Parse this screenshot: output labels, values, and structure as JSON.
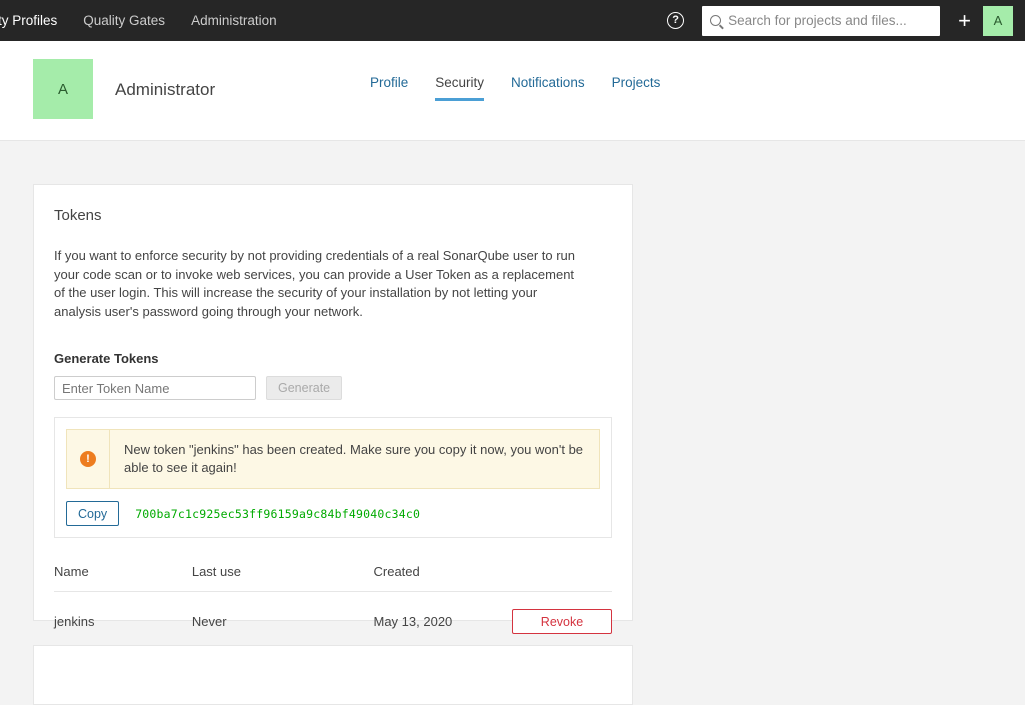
{
  "global_nav": {
    "menu_items": [
      {
        "label": "lity Profiles",
        "name": "nav-quality-profiles"
      },
      {
        "label": "Quality Gates",
        "name": "nav-quality-gates"
      },
      {
        "label": "Administration",
        "name": "nav-administration"
      }
    ],
    "help_icon": "help-icon",
    "help_glyph": "?",
    "search": {
      "placeholder": "Search for projects and files...",
      "value": "",
      "icon": "search-icon"
    },
    "plus_glyph": "+",
    "avatar_initial": "A"
  },
  "account": {
    "avatar_initial": "A",
    "name": "Administrator",
    "tabs": [
      {
        "label": "Profile",
        "active": false
      },
      {
        "label": "Security",
        "active": true
      },
      {
        "label": "Notifications",
        "active": false
      },
      {
        "label": "Projects",
        "active": false
      }
    ]
  },
  "tokens_card": {
    "title": "Tokens",
    "description": "If you want to enforce security by not providing credentials of a real SonarQube user to run your code scan or to invoke web services, you can provide a User Token as a replacement of the user login. This will increase the security of your installation by not letting your analysis user's password going through your network.",
    "generate_section_title": "Generate Tokens",
    "token_name_placeholder": "Enter Token Name",
    "token_name_value": "",
    "generate_button_label": "Generate",
    "alert": {
      "icon_glyph": "!",
      "message": "New token \"jenkins\" has been created. Make sure you copy it now, you won't be able to see it again!"
    },
    "copy_button_label": "Copy",
    "token_value": "700ba7c1c925ec53ff96159a9c84bf49040c34c0",
    "table": {
      "headers": [
        "Name",
        "Last use",
        "Created",
        ""
      ],
      "rows": [
        {
          "name": "jenkins",
          "last_use": "Never",
          "created": "May 13, 2020",
          "action_label": "Revoke"
        }
      ]
    }
  },
  "colors": {
    "navbar_bg": "#262626",
    "page_bg": "#f3f3f3",
    "avatar_green": "#a5ecaa",
    "tab_underline_blue": "#4b9fd5",
    "link_blue": "#236a97",
    "alert_bg": "#fdf8e5",
    "alert_icon_orange": "#ed7d20",
    "danger_red": "#d4333f",
    "token_green": "#00aa00"
  }
}
